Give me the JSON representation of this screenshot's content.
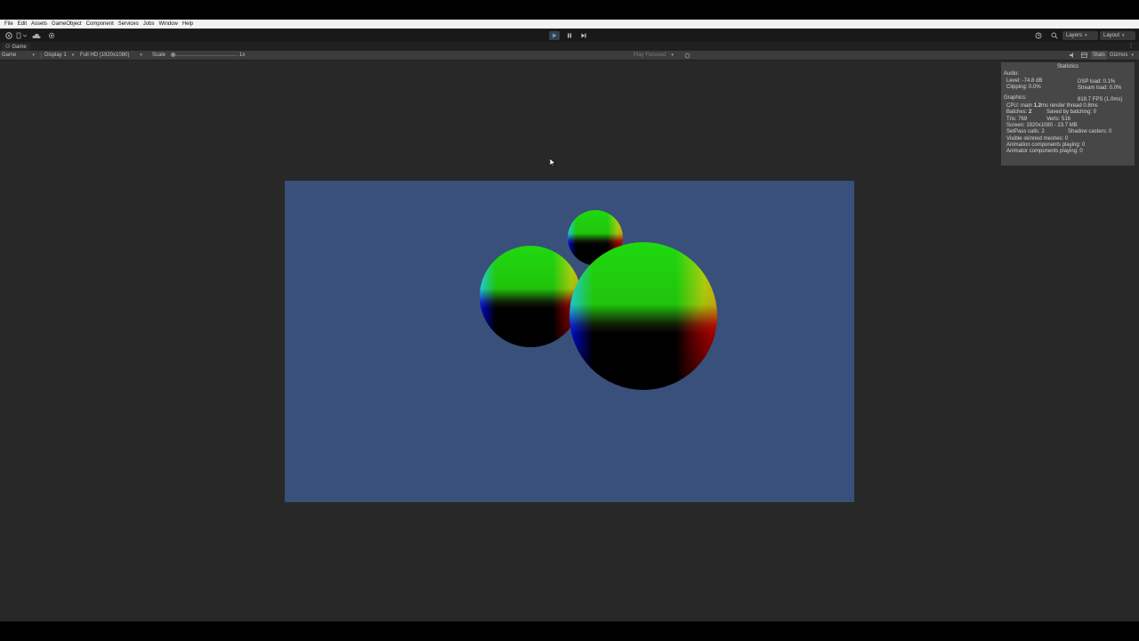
{
  "menu": [
    "File",
    "Edit",
    "Assets",
    "GameObject",
    "Component",
    "Services",
    "Jobs",
    "Window",
    "Help"
  ],
  "toolbar": {
    "play_icon": "play-icon",
    "pause_icon": "pause-icon",
    "step_icon": "step-icon",
    "layers_label": "Layers",
    "layout_label": "Layout"
  },
  "tab": {
    "label": "Game"
  },
  "gamebar": {
    "mode": "Game",
    "display": "Display 1",
    "resolution": "Full HD (1920x1080)",
    "scale_label": "Scale",
    "scale_value": "1x",
    "play_focused": "Play Focused",
    "stats_label": "Stats",
    "gizmos_label": "Gizmos"
  },
  "scene": {
    "background": "#38507a",
    "spheres": [
      "small-sphere",
      "left-sphere",
      "large-sphere"
    ]
  },
  "stats": {
    "title": "Statistics",
    "audio_header": "Audio:",
    "level": "Level: -74.8 dB",
    "clipping": "Clipping: 0.0%",
    "dsp": "DSP load: 0.1%",
    "stream": "Stream load: 0.0%",
    "graphics_header": "Graphics:",
    "fps": "818.7 FPS (1.0ms)",
    "cpu_prefix": "CPU: main ",
    "cpu_main": "1.2",
    "cpu_suffix": "ms  render thread 0.8ms",
    "batches_prefix": "Batches: ",
    "batches": "2",
    "saved": "Saved by batching: 0",
    "tris": "Tris: 769",
    "verts": "Verts: 516",
    "screen": "Screen: 1920x1080 - 23.7 MB",
    "setpass": "SetPass calls: 2",
    "shadow": "Shadow casters: 0",
    "skinned": "Visible skinned meshes: 0",
    "anim": "Animation components playing: 0",
    "animator": "Animator components playing: 0"
  }
}
